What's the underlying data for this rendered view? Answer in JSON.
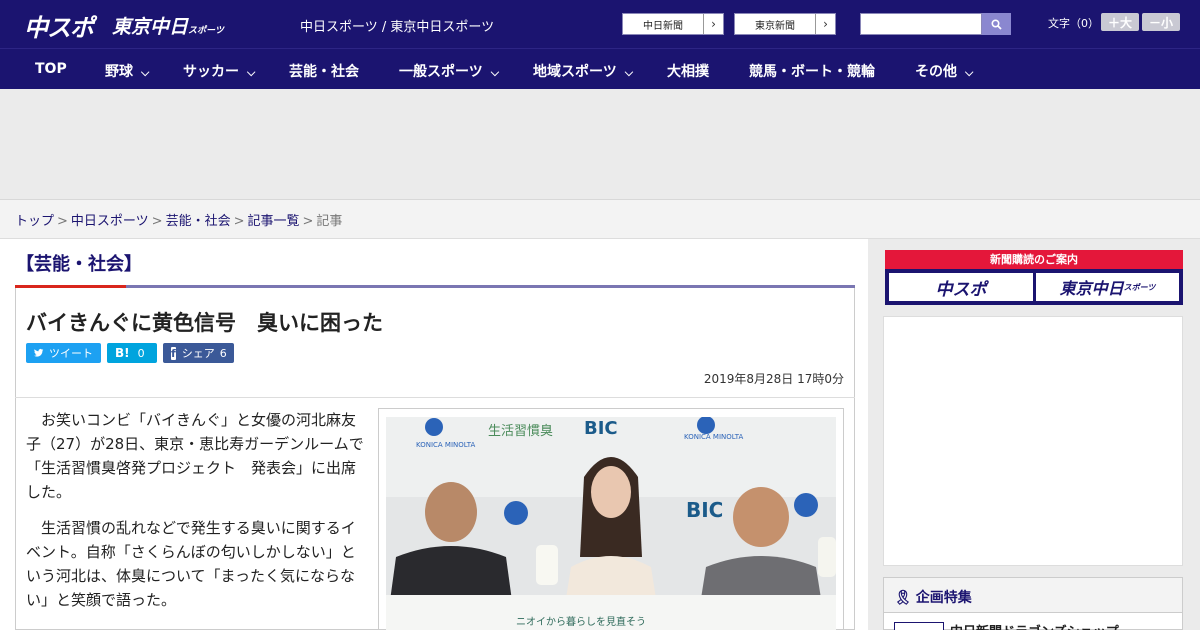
{
  "header": {
    "logo_chuspo": "中スポ",
    "logo_tokyo": "東京中日",
    "logo_tokyo_suffix": "スポーツ",
    "site_links": "中日スポーツ / 東京中日スポーツ",
    "paper_buttons": [
      "中日新聞",
      "東京新聞"
    ],
    "search_placeholder": "",
    "text_size_label": "文字（0）",
    "text_bigger": "＋大",
    "text_smaller": "－小"
  },
  "nav": [
    {
      "label": "TOP",
      "dropdown": false
    },
    {
      "label": "野球",
      "dropdown": true
    },
    {
      "label": "サッカー",
      "dropdown": true
    },
    {
      "label": "芸能・社会",
      "dropdown": false
    },
    {
      "label": "一般スポーツ",
      "dropdown": true
    },
    {
      "label": "地域スポーツ",
      "dropdown": true
    },
    {
      "label": "大相撲",
      "dropdown": false
    },
    {
      "label": "競馬・ボート・競輪",
      "dropdown": false
    },
    {
      "label": "その他",
      "dropdown": true
    }
  ],
  "breadcrumb": {
    "items": [
      "トップ",
      "中日スポーツ",
      "芸能・社会",
      "記事一覧"
    ],
    "current": "記事"
  },
  "article": {
    "category": "【芸能・社会】",
    "headline": "バイきんぐに黄色信号　臭いに困った",
    "share": {
      "tweet": "ツイート",
      "hatena_count": "0",
      "facebook_label": "シェア",
      "facebook_count": "6"
    },
    "date": "2019年8月28日 17時0分",
    "paragraphs": [
      "お笑いコンビ「バイきんぐ」と女優の河北麻友子（27）が28日、東京・恵比寿ガーデンルームで「生活習慣臭啓発プロジェクト　発表会」に出席した。",
      "生活習慣の乱れなどで発生する臭いに関するイベント。自称「さくらんぼの匂いしかしない」という河北は、体臭について「まったく気にならない」と笑顔で語った。"
    ],
    "photo_texts": {
      "konica": "KONICA MINOLTA",
      "seikatsu": "生活習慣臭",
      "bic": "BIC",
      "banner": "ニオイから暮らしを見直そう"
    }
  },
  "sidebar": {
    "subscription_title": "新聞購読のご案内",
    "sub_buttons": [
      "中スポ",
      "東京中日"
    ],
    "sub_button_suffix": "スポーツ",
    "feature_title": "企画特集",
    "feature_item": "中日新聞ドラゴンズショップ"
  },
  "colors": {
    "brand_navy": "#1b1470",
    "accent_red": "#d9261c",
    "twitter": "#1da1f2",
    "hatena": "#00a4de",
    "facebook": "#3b5998"
  }
}
